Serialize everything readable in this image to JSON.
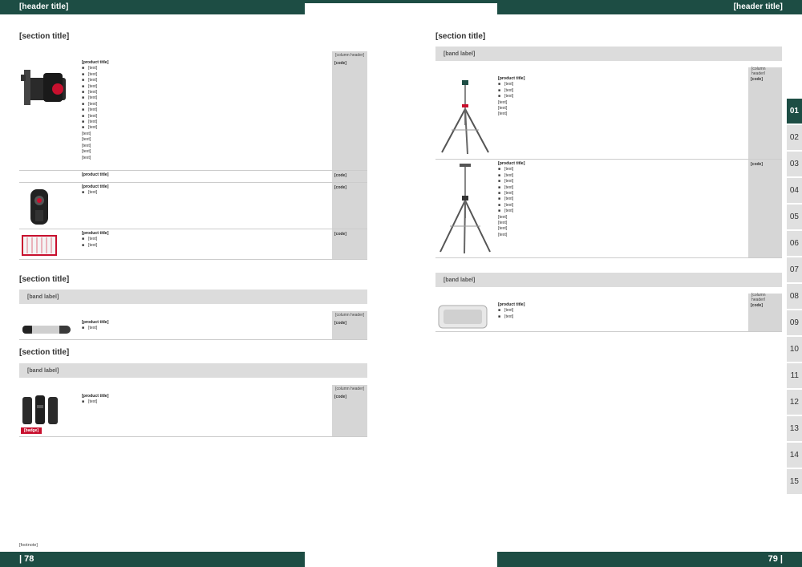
{
  "header": {
    "left_title": "[header title]",
    "right_title": "[header title]"
  },
  "footer": {
    "left_page": "| 78",
    "right_page": "79 |",
    "footnote": "[footnote]"
  },
  "order_no_label": "[column header]",
  "new_badge": "[badge]",
  "left": {
    "sec1_title": "[section title]",
    "sec1_products": [
      {
        "title": "[product title]",
        "bullets": [
          "[text]",
          "[text]",
          "[text]",
          "[text]",
          "[text]",
          "[text]",
          "[text]",
          "[text]",
          "[text]",
          "[text]",
          "[text]"
        ],
        "specs": [
          "[text]",
          "[text]",
          "[text]",
          "[text]",
          "[text]"
        ],
        "order": "[code]"
      },
      {
        "title": "[product title]",
        "bullets": [],
        "specs": [],
        "order": "[code]"
      },
      {
        "title": "[product title]",
        "bullets": [
          "[text]"
        ],
        "specs": [],
        "order": "[code]"
      },
      {
        "title": "[product title]",
        "bullets": [
          "[text]",
          "[text]"
        ],
        "specs": [],
        "order": "[code]"
      }
    ],
    "sec2_title": "[section title]",
    "sec2_band": "[band label]",
    "sec2_product": {
      "title": "[product title]",
      "bullets": [
        "[text]"
      ],
      "order": "[code]"
    },
    "sec3_title": "[section title]",
    "sec3_band": "[band label]",
    "sec3_product": {
      "title": "[product title]",
      "bullets": [
        "[text]"
      ],
      "order": "[code]"
    }
  },
  "right": {
    "sec_title": "[section title]",
    "band1": "[band label]",
    "tripods": [
      {
        "title": "[product title]",
        "bullets": [
          "[text]",
          "[text]",
          "[text]"
        ],
        "specs": [
          "[text]",
          "[text]",
          "[text]"
        ],
        "order": "[code]"
      },
      {
        "title": "[product title]",
        "bullets": [
          "[text]",
          "[text]",
          "[text]",
          "[text]",
          "[text]",
          "[text]",
          "[text]",
          "[text]"
        ],
        "specs": [
          "[text]",
          "[text]",
          "[text]",
          "[text]"
        ],
        "order": "[code]"
      }
    ],
    "band2": "[band label]",
    "panel": {
      "title": "[product title]",
      "bullets": [
        "[text]",
        "[text]"
      ],
      "order": "[code]"
    }
  },
  "tabs": [
    "01",
    "02",
    "03",
    "04",
    "05",
    "06",
    "07",
    "08",
    "09",
    "10",
    "11",
    "12",
    "13",
    "14",
    "15"
  ],
  "active_tab": "01",
  "colors": {
    "brand_green": "#1d4d44",
    "badge_red": "#c8102e",
    "band_gray": "#dcdcdc"
  }
}
